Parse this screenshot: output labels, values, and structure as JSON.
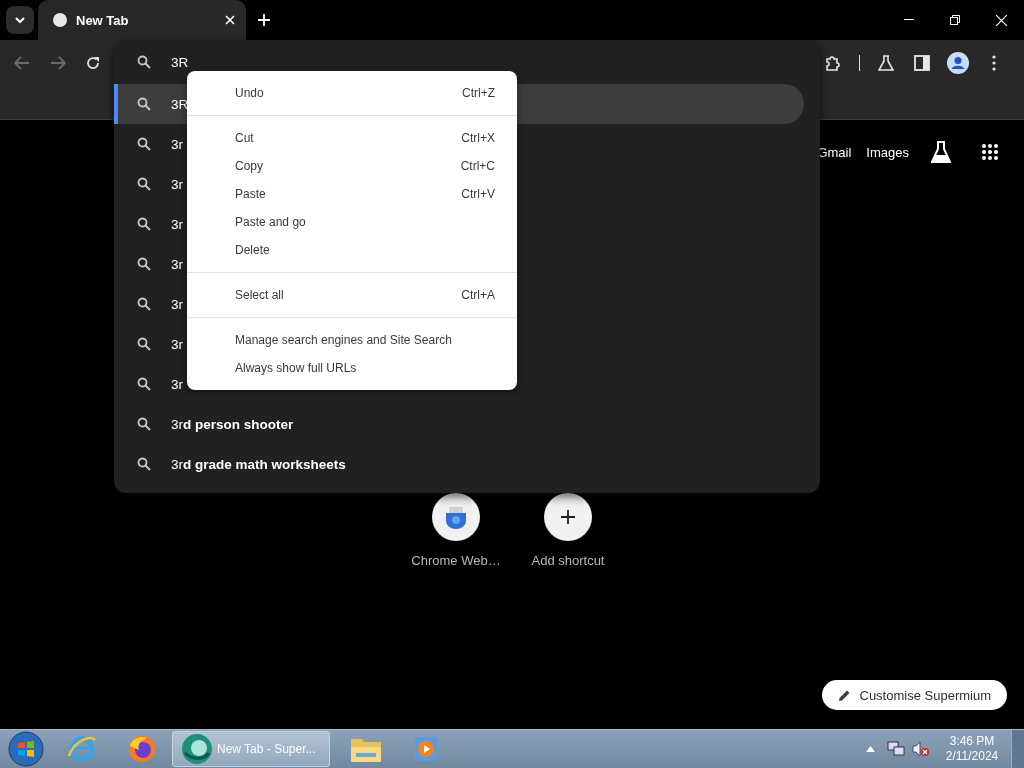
{
  "tab_strip": {
    "tabs": [
      {
        "title": "New Tab",
        "selected": true
      }
    ]
  },
  "toolbar": {
    "back": {
      "disabled": true
    },
    "forward": {
      "disabled": true
    }
  },
  "omnibox": {
    "value": "3R",
    "suggestions": [
      {
        "text": "3R",
        "selected": true
      },
      {
        "text": "3r",
        "selected": false
      },
      {
        "text": "3r",
        "selected": false
      },
      {
        "text": "3r",
        "selected": false
      },
      {
        "text": "3r",
        "selected": false
      },
      {
        "text": "3r",
        "selected": false
      },
      {
        "text": "3r",
        "selected": false
      },
      {
        "text": "3r",
        "selected": false
      },
      {
        "text": "3r**d person shooter**",
        "selected": false
      },
      {
        "text": "3r**d grade math worksheets**",
        "selected": false
      }
    ]
  },
  "context_menu": {
    "groups": [
      [
        {
          "label": "Undo",
          "shortcut": "Ctrl+Z"
        }
      ],
      [
        {
          "label": "Cut",
          "shortcut": "Ctrl+X"
        },
        {
          "label": "Copy",
          "shortcut": "Ctrl+C"
        },
        {
          "label": "Paste",
          "shortcut": "Ctrl+V"
        },
        {
          "label": "Paste and go"
        },
        {
          "label": "Delete"
        }
      ],
      [
        {
          "label": "Select all",
          "shortcut": "Ctrl+A"
        }
      ],
      [
        {
          "label": "Manage search engines and Site Search"
        },
        {
          "label": "Always show full URLs"
        }
      ]
    ]
  },
  "new_tab_page": {
    "header_links": [
      "Gmail",
      "Images"
    ],
    "shortcuts": [
      {
        "title": "Chrome Web…",
        "kind": "site"
      },
      {
        "title": "Add shortcut",
        "kind": "add"
      }
    ],
    "customise_button": "Customise Supermium"
  },
  "taskbar": {
    "task_button": "New Tab - Super...",
    "time": "3:46 PM",
    "date": "2/11/2024"
  }
}
